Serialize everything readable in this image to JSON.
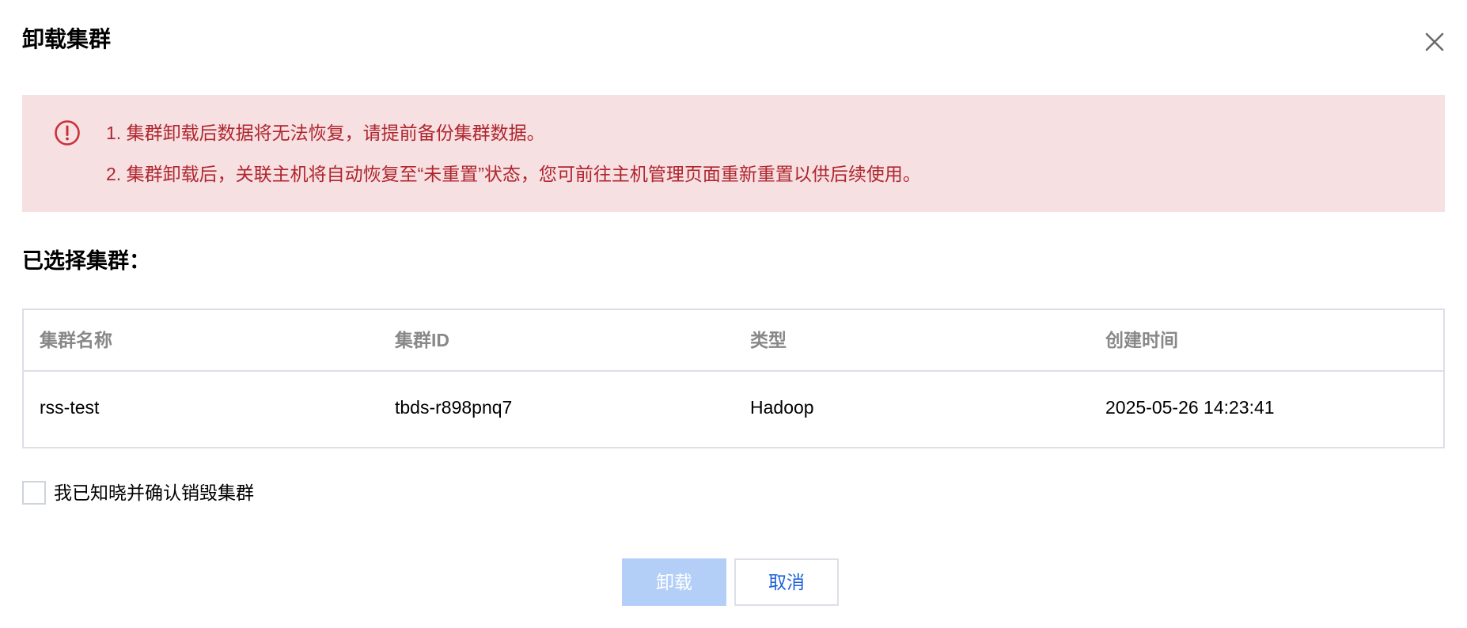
{
  "dialog": {
    "title": "卸载集群",
    "close_icon": "close-icon"
  },
  "alert": {
    "icon": "exclamation-circle-icon",
    "color": "#b0262f",
    "background": "#f6e0e1",
    "lines": [
      "1. 集群卸载后数据将无法恢复，请提前备份集群数据。",
      "2. 集群卸载后，关联主机将自动恢复至“未重置”状态，您可前往主机管理页面重新重置以供后续使用。"
    ]
  },
  "selected": {
    "title": "已选择集群："
  },
  "table": {
    "headers": [
      "集群名称",
      "集群ID",
      "类型",
      "创建时间"
    ],
    "rows": [
      [
        "rss-test",
        "tbds-r898pnq7",
        "Hadoop",
        "2025-05-26 14:23:41"
      ]
    ]
  },
  "confirm": {
    "label": "我已知晓并确认销毁集群",
    "checked": false
  },
  "buttons": {
    "uninstall_label": "卸载",
    "uninstall_disabled": true,
    "cancel_label": "取消"
  },
  "colors": {
    "primary_disabled": "#b4cff7",
    "link_blue": "#1f63d9",
    "border": "#dcdfe6"
  }
}
